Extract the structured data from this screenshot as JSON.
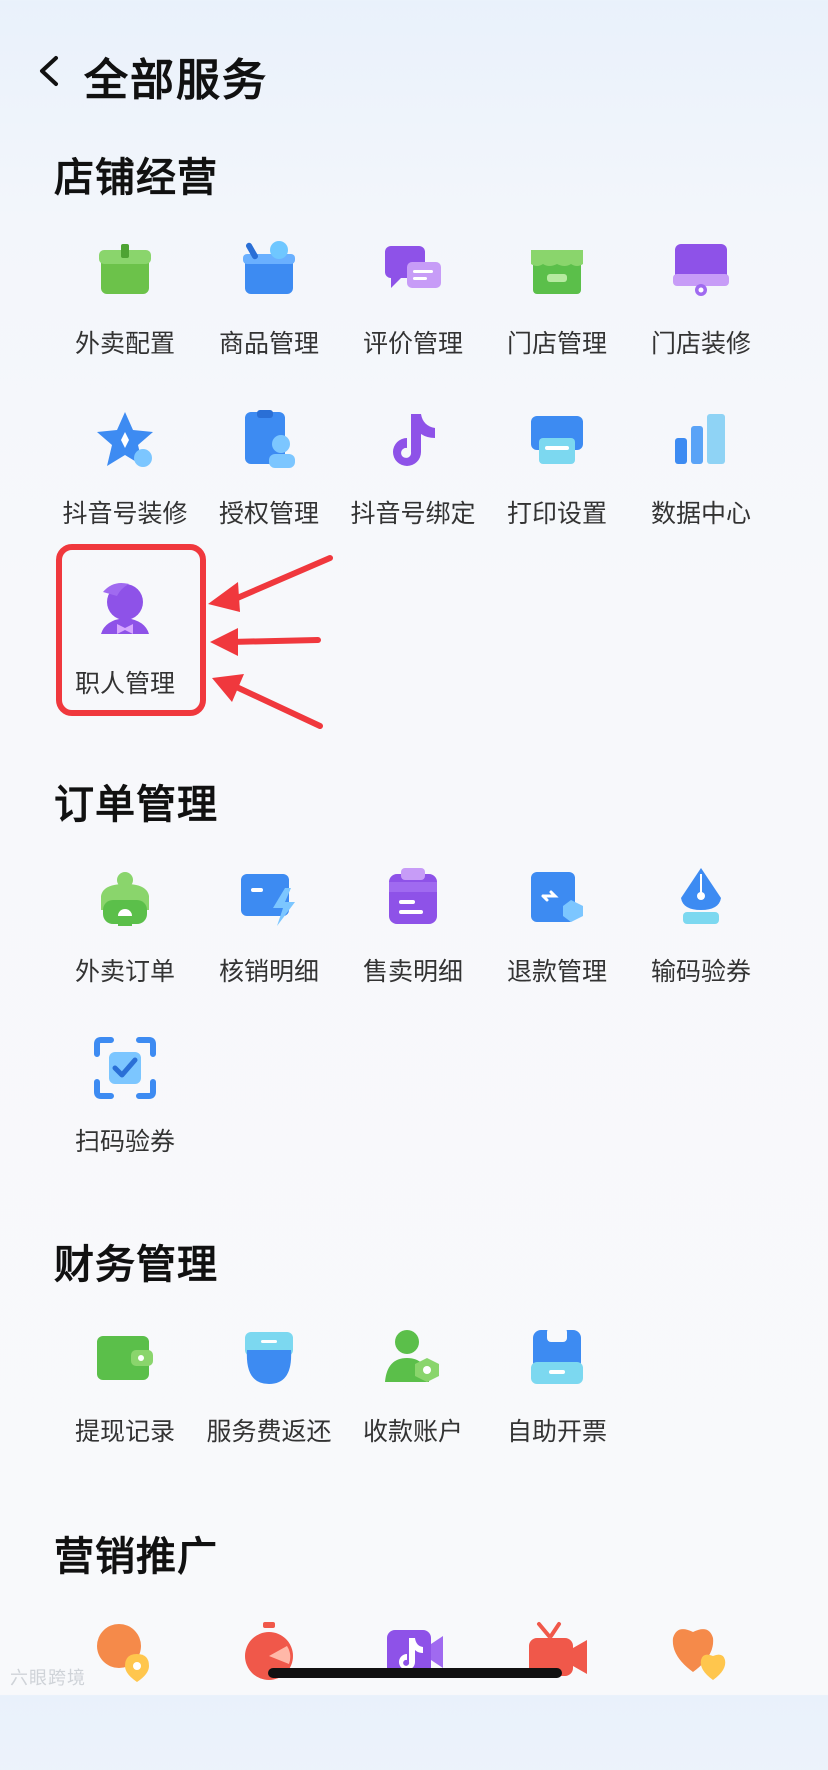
{
  "header": {
    "title": "全部服务"
  },
  "sections": {
    "store": {
      "title": "店铺经营",
      "items": [
        "外卖配置",
        "商品管理",
        "评价管理",
        "门店管理",
        "门店装修",
        "抖音号装修",
        "授权管理",
        "抖音号绑定",
        "打印设置",
        "数据中心",
        "职人管理"
      ]
    },
    "orders": {
      "title": "订单管理",
      "items": [
        "外卖订单",
        "核销明细",
        "售卖明细",
        "退款管理",
        "输码验券",
        "扫码验券"
      ]
    },
    "finance": {
      "title": "财务管理",
      "items": [
        "提现记录",
        "服务费返还",
        "收款账户",
        "自助开票"
      ]
    },
    "marketing": {
      "title": "营销推广"
    }
  },
  "watermark": "六眼跨境",
  "colors": {
    "highlight": "#f0383d",
    "purple": "#8e52e8",
    "blue": "#3d8bf2",
    "green": "#5bbf4a"
  }
}
